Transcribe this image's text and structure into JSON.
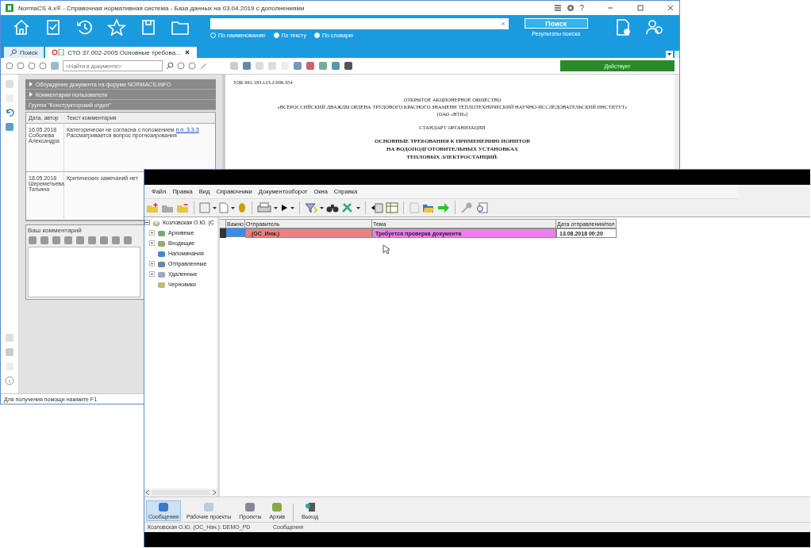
{
  "main_window": {
    "title": "NormaCS 4.x® - Справочная нормативная система - База данных на 03.04.2019 с дополнениями",
    "help_label": "?",
    "search_modes": [
      {
        "label": "По наименованию",
        "selected": true
      },
      {
        "label": "По тексту",
        "selected": false
      },
      {
        "label": "По словарю",
        "selected": false
      }
    ],
    "search_button": "Поиск",
    "search_results_link": "Результаты поиска",
    "tabs": [
      {
        "label": "Поиск",
        "selected": false
      },
      {
        "label": "СТО 37.002-2005 Основные требова...",
        "selected": true
      }
    ],
    "find_field": {
      "placeholder": "<Найти в документе>"
    },
    "doc_status": "Действует",
    "comments_panel": {
      "sections": [
        "Обсуждение документа на форуме NORMACS.INFO",
        "Комментарии пользователя"
      ],
      "group_title": "Группа \"Конструкторский отдел\"",
      "columns": [
        "Дата, автор",
        "Текст комментария"
      ],
      "rows": [
        {
          "date": "16.05.2018",
          "author": "Соболева Александра",
          "text": "Категорически не согласна с положением",
          "link": "п.п. 3.3.3",
          "text_2": "Рассматривается вопрос прогнозирования"
        },
        {
          "date": "18.05.2018",
          "author": "Шереметьева Татьяна",
          "text": "Критических замечаний нет"
        }
      ],
      "editor_label": "Ваш комментарий"
    },
    "document": {
      "udk": "УДК 661.183.123.2:006.354",
      "lines": [
        {
          "text": "ОТКРЫТОЕ АКЦИОНЕРНОЕ ОБЩЕСТВО",
          "bold": false
        },
        {
          "text": "«ВСЕРОССИЙСКИЙ ДВАЖДЫ ОРДЕНА ТРУДОВОГО КРАСНОГО ЗНАМЕНИ ТЕПЛОТЕХНИЧЕСКИЙ НАУЧНО-ИССЛЕДОВАТЕЛЬСКИЙ ИНСТИТУТ»",
          "bold": false
        },
        {
          "text": "(ОАО «ВТИ»)",
          "bold": false
        },
        {
          "text": "СТАНДАРТ ОРГАНИЗАЦИИ",
          "bold": false
        },
        {
          "text": "ОСНОВНЫЕ ТРЕБОВАНИЯ К ПРИМЕНЕНИЮ ИОНИТОВ",
          "bold": true
        },
        {
          "text": "НА ВОДОПОДГОТОВИТЕЛЬНЫХ УСТАНОВКАХ",
          "bold": true
        },
        {
          "text": "ТЕПЛОВЫХ ЭЛЕКТРОСТАНЦИЙ.",
          "bold": true
        }
      ]
    },
    "status_bar": "Для получения помощи нажмите F1"
  },
  "messages_window": {
    "menu": [
      "Файл",
      "Правка",
      "Вид",
      "Справочники",
      "Документооборот",
      "Окна",
      "Справка"
    ],
    "tree": {
      "label": "Козловская О.Ю. (С",
      "expanded": true,
      "children": [
        {
          "label": "Архивные",
          "expandable": true
        },
        {
          "label": "Входящие",
          "expandable": true
        },
        {
          "label": "Напоминания",
          "expandable": false
        },
        {
          "label": "Отправленные",
          "expandable": true
        },
        {
          "label": "Удаленные",
          "expandable": true
        },
        {
          "label": "Черновики",
          "expandable": false
        }
      ]
    },
    "table": {
      "columns": [
        "Важно",
        "Отправитель",
        "Тема",
        "Дата отправления/пол"
      ],
      "rows": [
        {
          "selected": true,
          "cells": [
            {
              "color": "#3b8ee8"
            },
            {
              "text": "_(ОС_Инж.)",
              "color": "#f08080"
            },
            {
              "text": "Требуется проверка документа",
              "color": "#f07cf0"
            },
            {
              "text": "13.08.2018 00:20",
              "color": "#ffffff"
            }
          ]
        }
      ]
    },
    "nav_buttons": [
      {
        "label": "Сообщения",
        "selected": true
      },
      {
        "label": "Рабочие проекты",
        "selected": false
      },
      {
        "label": "Проекты",
        "selected": false
      },
      {
        "label": "Архив",
        "selected": false
      }
    ],
    "exit_button": "Выход",
    "status_bar": [
      "Козловская О.Ю. (ОС_Нач.): DEMO_PD",
      "Сообщения"
    ]
  }
}
